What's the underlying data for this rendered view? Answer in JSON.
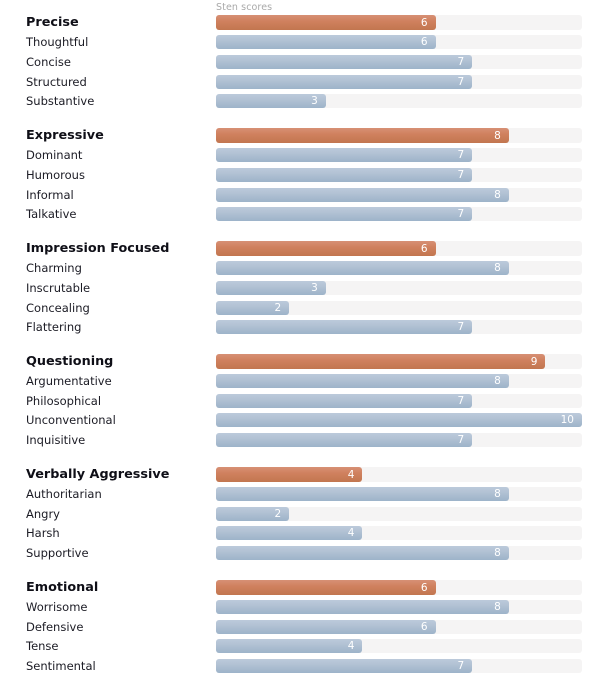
{
  "axis": {
    "label": "Sten scores"
  },
  "scale": {
    "min": 0,
    "max": 10
  },
  "colors": {
    "primary_bar": "#cc7f63",
    "secondary_bar": "#a7bcd0",
    "track": "#f5f4f4",
    "label_text": "#1b1b24",
    "axis_text": "#a9a9a9",
    "value_text": "#ffffff"
  },
  "chart_data": {
    "type": "bar",
    "title": "",
    "subtitle": "",
    "xlabel": "Sten scores",
    "ylabel": "",
    "xlim": [
      0,
      10
    ],
    "grid": false,
    "legend": null,
    "orientation": "horizontal",
    "categories": [
      "Precise",
      "Thoughtful",
      "Concise",
      "Structured",
      "Substantive",
      "Expressive",
      "Dominant",
      "Humorous",
      "Informal",
      "Talkative",
      "Impression Focused",
      "Charming",
      "Inscrutable",
      "Concealing",
      "Flattering",
      "Questioning",
      "Argumentative",
      "Philosophical",
      "Unconventional",
      "Inquisitive",
      "Verbally Aggressive",
      "Authoritarian",
      "Angry",
      "Harsh",
      "Supportive",
      "Emotional",
      "Worrisome",
      "Defensive",
      "Tense",
      "Sentimental"
    ],
    "values": [
      6,
      6,
      7,
      7,
      3,
      8,
      7,
      7,
      8,
      7,
      6,
      8,
      3,
      2,
      7,
      9,
      8,
      7,
      10,
      7,
      4,
      8,
      2,
      4,
      8,
      6,
      8,
      6,
      4,
      7
    ]
  },
  "groups": [
    {
      "rows": [
        {
          "label": "Precise",
          "value": 6,
          "heading": true
        },
        {
          "label": "Thoughtful",
          "value": 6,
          "heading": false
        },
        {
          "label": "Concise",
          "value": 7,
          "heading": false
        },
        {
          "label": "Structured",
          "value": 7,
          "heading": false
        },
        {
          "label": "Substantive",
          "value": 3,
          "heading": false
        }
      ]
    },
    {
      "rows": [
        {
          "label": "Expressive",
          "value": 8,
          "heading": true
        },
        {
          "label": "Dominant",
          "value": 7,
          "heading": false
        },
        {
          "label": "Humorous",
          "value": 7,
          "heading": false
        },
        {
          "label": "Informal",
          "value": 8,
          "heading": false
        },
        {
          "label": "Talkative",
          "value": 7,
          "heading": false
        }
      ]
    },
    {
      "rows": [
        {
          "label": "Impression Focused",
          "value": 6,
          "heading": true
        },
        {
          "label": "Charming",
          "value": 8,
          "heading": false
        },
        {
          "label": "Inscrutable",
          "value": 3,
          "heading": false
        },
        {
          "label": "Concealing",
          "value": 2,
          "heading": false
        },
        {
          "label": "Flattering",
          "value": 7,
          "heading": false
        }
      ]
    },
    {
      "rows": [
        {
          "label": "Questioning",
          "value": 9,
          "heading": true
        },
        {
          "label": "Argumentative",
          "value": 8,
          "heading": false
        },
        {
          "label": "Philosophical",
          "value": 7,
          "heading": false
        },
        {
          "label": "Unconventional",
          "value": 10,
          "heading": false
        },
        {
          "label": "Inquisitive",
          "value": 7,
          "heading": false
        }
      ]
    },
    {
      "rows": [
        {
          "label": "Verbally Aggressive",
          "value": 4,
          "heading": true
        },
        {
          "label": "Authoritarian",
          "value": 8,
          "heading": false
        },
        {
          "label": "Angry",
          "value": 2,
          "heading": false
        },
        {
          "label": "Harsh",
          "value": 4,
          "heading": false
        },
        {
          "label": "Supportive",
          "value": 8,
          "heading": false
        }
      ]
    },
    {
      "rows": [
        {
          "label": "Emotional",
          "value": 6,
          "heading": true
        },
        {
          "label": "Worrisome",
          "value": 8,
          "heading": false
        },
        {
          "label": "Defensive",
          "value": 6,
          "heading": false
        },
        {
          "label": "Tense",
          "value": 4,
          "heading": false
        },
        {
          "label": "Sentimental",
          "value": 7,
          "heading": false
        }
      ]
    }
  ]
}
